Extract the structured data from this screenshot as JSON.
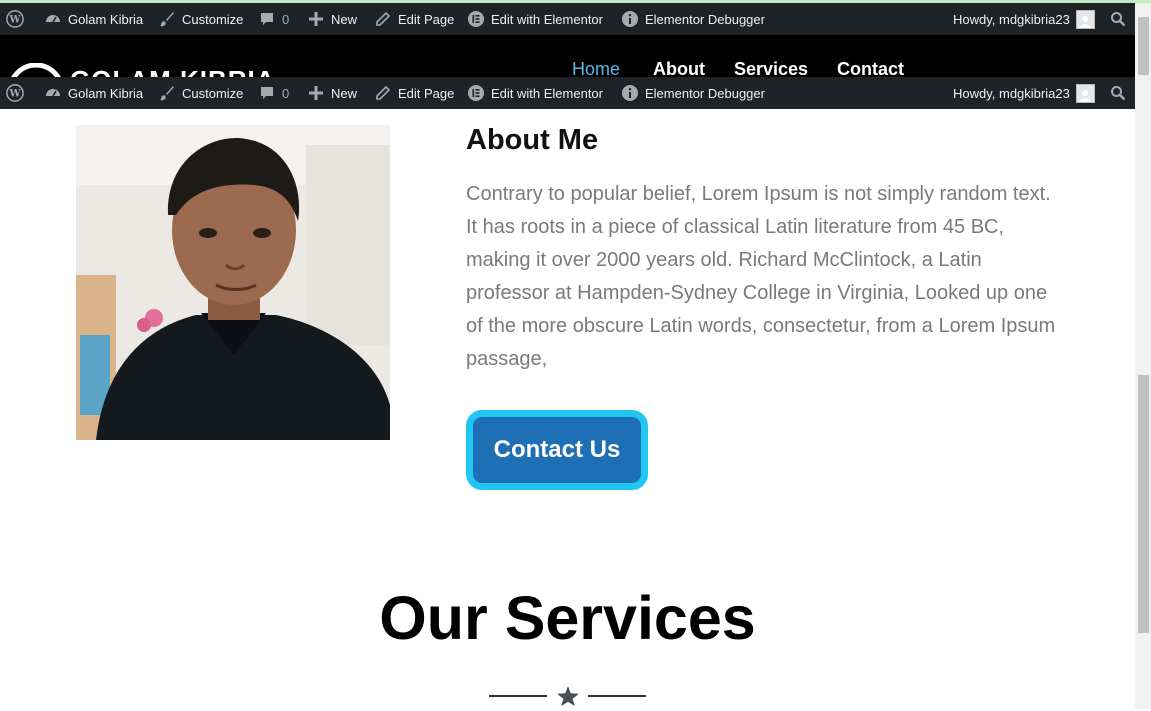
{
  "admin_bar": {
    "site_name": "Golam Kibria",
    "customize": "Customize",
    "comments_count": "0",
    "new": "New",
    "edit_page": "Edit Page",
    "edit_elementor": "Edit with Elementor",
    "elementor_debugger": "Elementor Debugger",
    "howdy": "Howdy, mdgkibria23"
  },
  "header": {
    "logo_text": "GOLAM KIBRIA",
    "nav": [
      "Home",
      "About",
      "Services",
      "Contact"
    ],
    "active_nav": "Home",
    "accent_color": "#5cb6e6"
  },
  "about": {
    "title": "About Me",
    "text": "Contrary to popular belief, Lorem Ipsum is not simply random text. It has roots in a piece of classical Latin literature from 45 BC, making it over 2000 years old. Richard McClintock, a Latin professor at Hampden-Sydney College in Virginia, Looked up one of the more obscure Latin words, consectetur, from a Lorem Ipsum passage,",
    "button": "Contact Us",
    "button_color": "#1e6fb3",
    "button_border_color": "#1fc7f2"
  },
  "services": {
    "title": "Our Services",
    "divider_icon": "star-icon"
  }
}
